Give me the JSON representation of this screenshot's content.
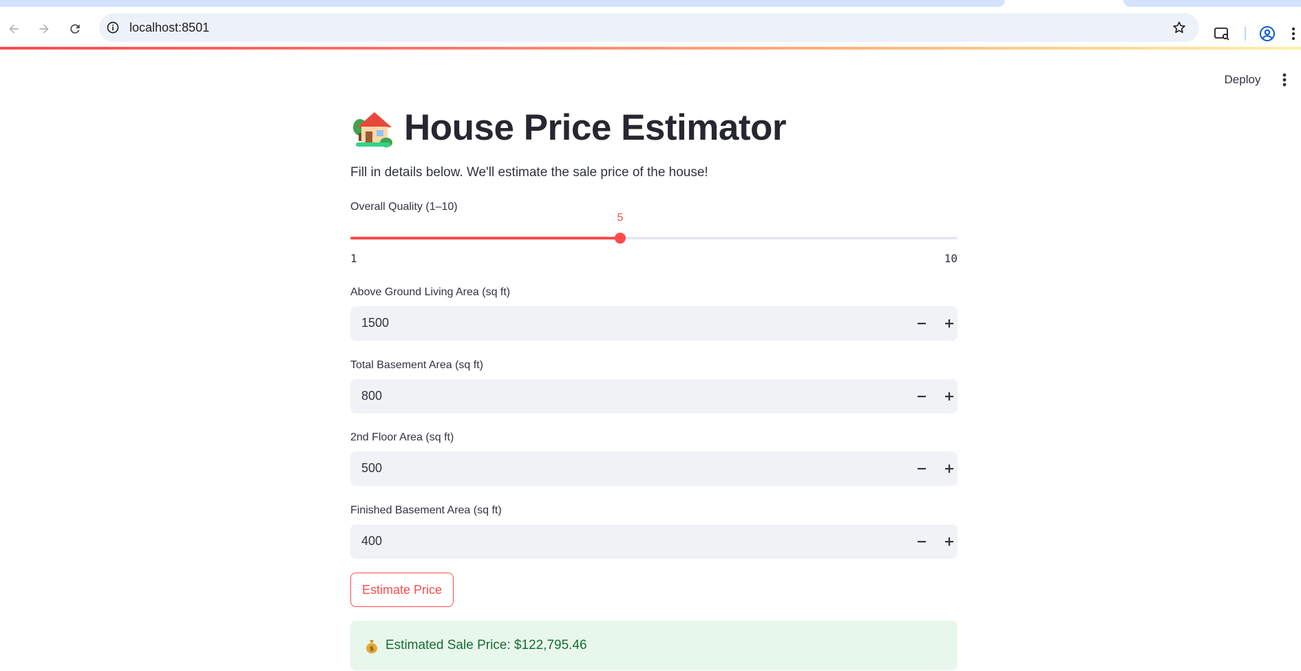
{
  "browser": {
    "url": "localhost:8501"
  },
  "header": {
    "deploy_label": "Deploy"
  },
  "page": {
    "title": "House Price Estimator",
    "title_emoji": "house-with-garden",
    "subtitle": "Fill in details below. We'll estimate the sale price of the house!"
  },
  "slider": {
    "label": "Overall Quality (1–10)",
    "value": 5,
    "value_text": "5",
    "min": 1,
    "max": 10,
    "min_text": "1",
    "max_text": "10",
    "color": "#ff4b4b"
  },
  "inputs": [
    {
      "label": "Above Ground Living Area (sq ft)",
      "value": "1500"
    },
    {
      "label": "Total Basement Area (sq ft)",
      "value": "800"
    },
    {
      "label": "2nd Floor Area (sq ft)",
      "value": "500"
    },
    {
      "label": "Finished Basement Area (sq ft)",
      "value": "400"
    }
  ],
  "button": {
    "label": "Estimate Price"
  },
  "result": {
    "icon": "money-bag-icon",
    "text": "Estimated Sale Price: $122,795.46",
    "bg_color": "#e8f7ec",
    "text_color": "#176c34"
  }
}
